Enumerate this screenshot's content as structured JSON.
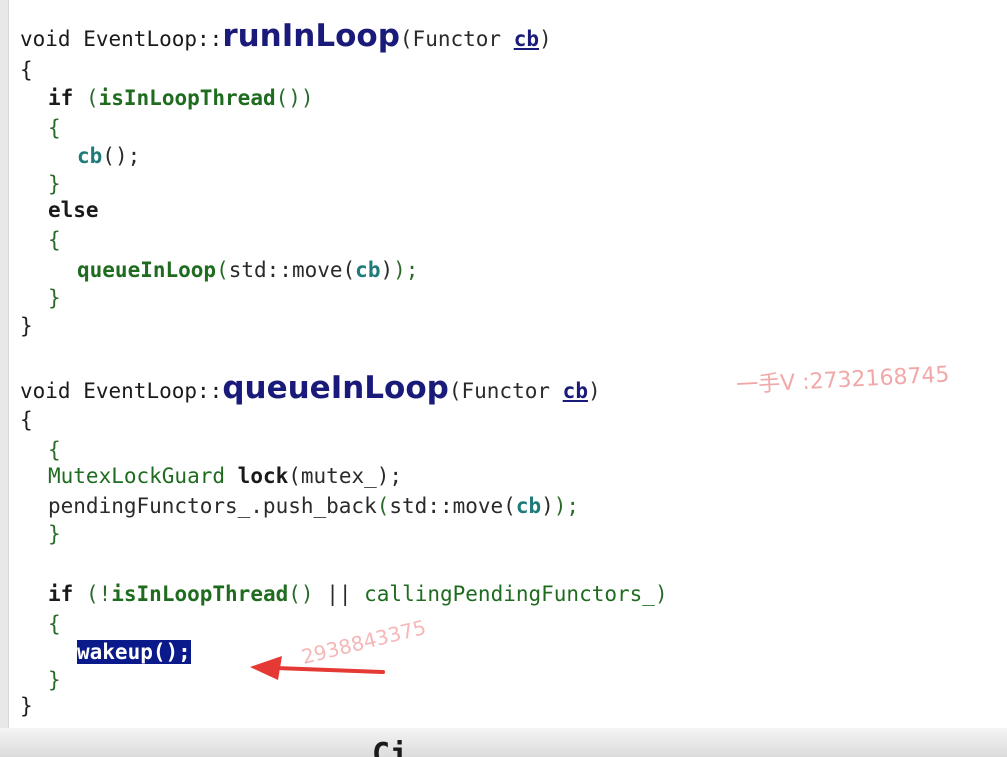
{
  "func1": {
    "void_kw": "void",
    "class_prefix": "EventLoop::",
    "name": "runInLoop",
    "open_paren": "(",
    "param_type": "Functor",
    "param_name": "cb",
    "close_paren": ")",
    "open_brace": "{",
    "if_kw": "if",
    "if_open": "(",
    "cond_call": "isInLoopThread",
    "cond_parens": "()",
    "if_close": ")",
    "brace_open_1": "{",
    "call_cb": "cb",
    "call_cb_rest": "();",
    "brace_close_1": "}",
    "else_kw": "else",
    "brace_open_2": "{",
    "queue_call": "queueInLoop",
    "queue_open": "(",
    "queue_arg_prefix": "std::move(",
    "queue_arg": "cb",
    "queue_arg_close": ")",
    "queue_close": ");",
    "brace_close_2": "}",
    "close_brace": "}"
  },
  "func2": {
    "void_kw": "void",
    "class_prefix": "EventLoop::",
    "name": "queueInLoop",
    "open_paren": "(",
    "param_type": "Functor",
    "param_name": "cb",
    "close_paren": ")",
    "open_brace": "{",
    "scope_open": "{",
    "guard_type": "MutexLockGuard",
    "guard_var": "lock",
    "guard_args": "(mutex_);",
    "push_obj": "pendingFunctors_.push_back",
    "push_open": "(",
    "push_arg_prefix": "std::move(",
    "push_arg": "cb",
    "push_arg_close": ")",
    "push_close": ");",
    "scope_close": "}",
    "if_kw": "if",
    "if_open": "(!",
    "cond_call": "isInLoopThread",
    "cond_parens": "()",
    "or_op": " || ",
    "cond_flag": "callingPendingFunctors_",
    "if_close": ")",
    "brace_open": "{",
    "wakeup": "wakeup();",
    "brace_close": "}",
    "close_brace": "}"
  },
  "watermarks": {
    "top": "一手V :2732168745",
    "bottom": "2938843375"
  },
  "bottom_fragment": "Ci",
  "colors": {
    "selection": "#0a1a8a",
    "arrow": "#e53935",
    "function_name": "#1a1a7a",
    "call": "#1f6b1f"
  }
}
